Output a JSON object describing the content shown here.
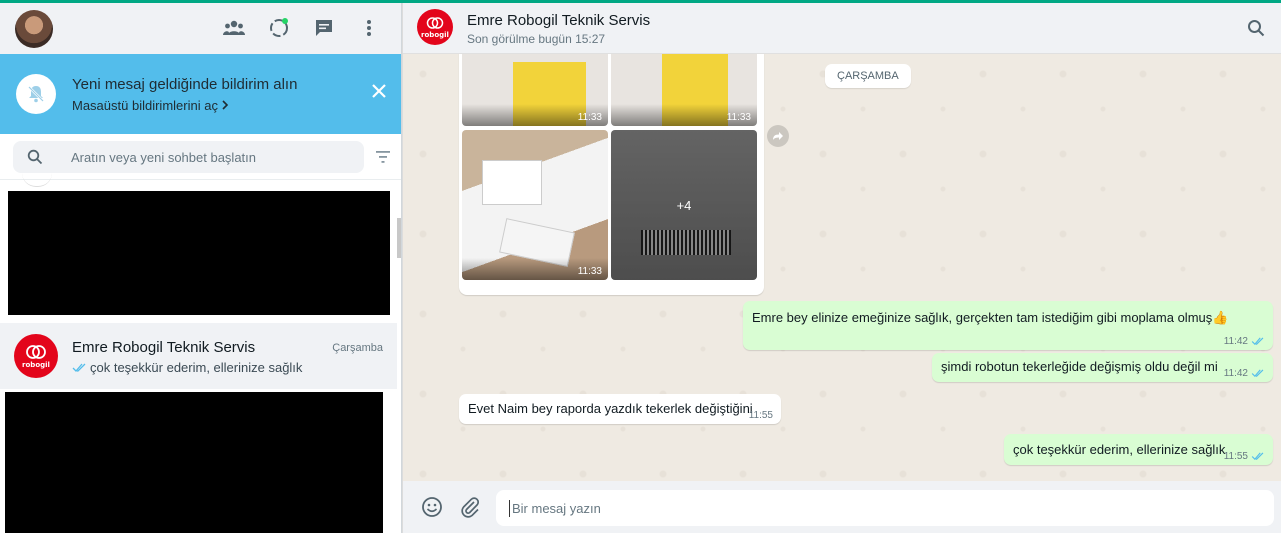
{
  "notification": {
    "title": "Yeni mesaj geldiğinde bildirim alın",
    "link": "Masaüstü bildirimlerini aç"
  },
  "search": {
    "placeholder": "Aratın veya yeni sohbet başlatın"
  },
  "chat_list": {
    "items": [
      {
        "name": "Emre Robogil Teknik Servis",
        "time": "Çarşamba",
        "preview": "çok teşekkür ederim, ellerinize sağlık",
        "avatar_text": "robogil"
      }
    ]
  },
  "conversation": {
    "name": "Emre Robogil Teknik Servis",
    "status": "Son görülme bugün 15:27",
    "avatar_text": "robogil",
    "day_chip": "ÇARŞAMBA",
    "media": {
      "times": [
        "11:33",
        "11:33",
        "11:33"
      ],
      "more_count": "+4"
    },
    "messages": [
      {
        "direction": "out",
        "text": "Emre bey elinize emeğinize sağlık, gerçekten tam istediğim gibi moplama olmuş👍",
        "time": "11:42"
      },
      {
        "direction": "out",
        "text": "şimdi robotun tekerleğide değişmiş oldu değil mi",
        "time": "11:42"
      },
      {
        "direction": "in",
        "text": "Evet Naim bey raporda yazdık tekerlek değiştiğini",
        "time": "11:55"
      },
      {
        "direction": "out",
        "text": "çok teşekkür ederim, ellerinize sağlık",
        "time": "11:55"
      }
    ]
  },
  "composer": {
    "placeholder": "Bir mesaj yazın"
  },
  "colors": {
    "accent": "#00a884",
    "notification_bg": "#53bdeb",
    "outgoing_bubble": "#d9fdd3",
    "read_tick": "#53bdeb",
    "brand_red": "#e3051b"
  }
}
